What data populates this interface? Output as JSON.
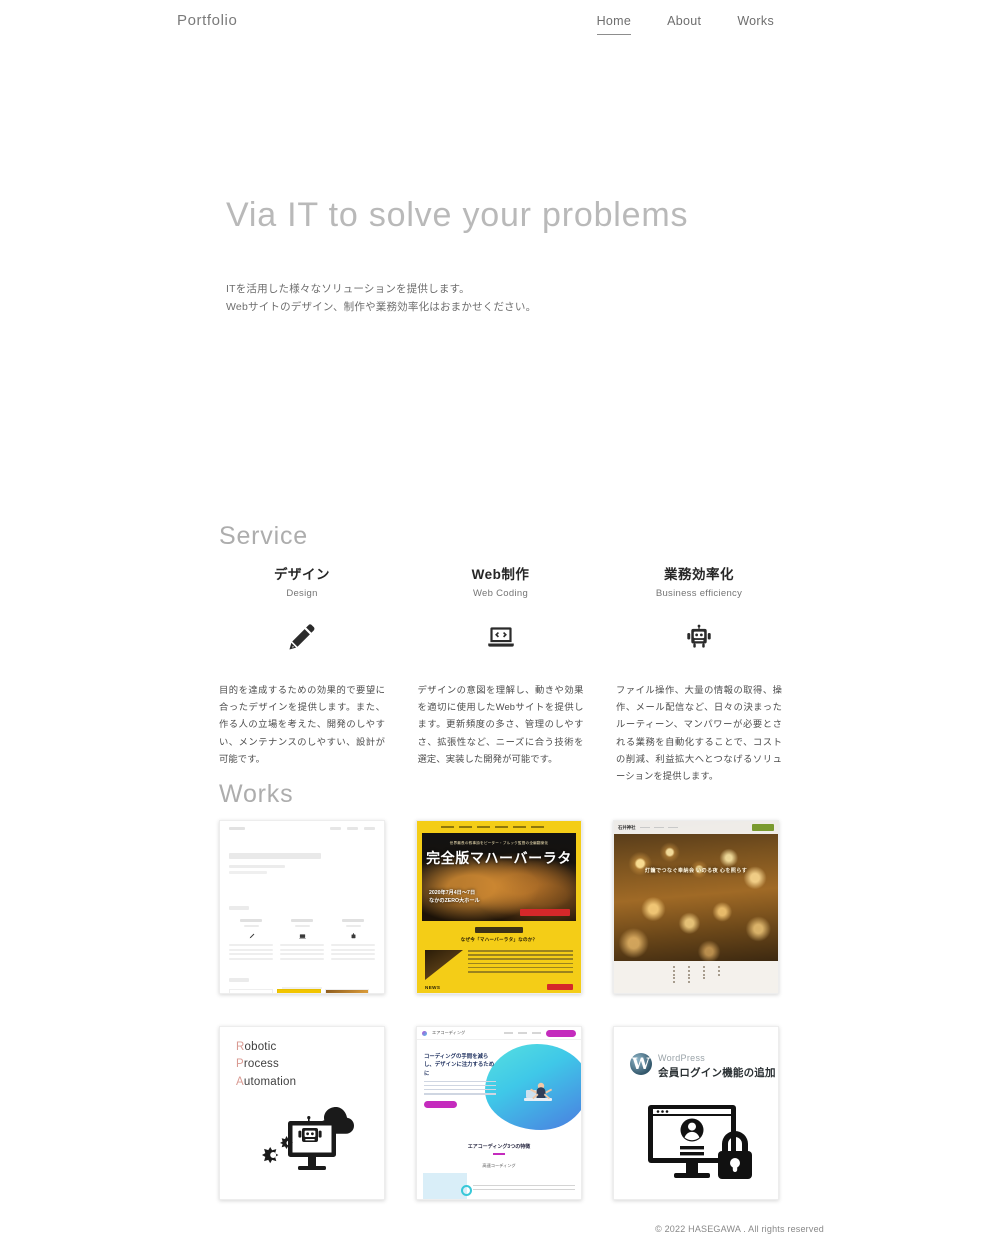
{
  "header": {
    "logo": "Portfolio",
    "nav": [
      {
        "label": "Home",
        "active": true
      },
      {
        "label": "About",
        "active": false
      },
      {
        "label": "Works",
        "active": false
      }
    ]
  },
  "hero": {
    "title": "Via IT to solve your problems",
    "sub_line1": "ITを活用した様々なソリューションを提供します。",
    "sub_line2": "Webサイトのデザイン、制作や業務効率化はおまかせください。"
  },
  "service": {
    "heading": "Service",
    "items": [
      {
        "title_jp": "デザイン",
        "title_en": "Design",
        "icon": "pen-nib-icon",
        "desc": "目的を達成するための効果的で要望に合ったデザインを提供します。また、作る人の立場を考えた、開発のしやすい、メンテナンスのしやすい、設計が可能です。"
      },
      {
        "title_jp": "Web制作",
        "title_en": "Web Coding",
        "icon": "laptop-code-icon",
        "desc": "デザインの意図を理解し、動きや効果を適切に使用したWebサイトを提供します。更新頻度の多さ、管理のしやすさ、拡張性など、ニーズに合う技術を選定、実装した開発が可能です。"
      },
      {
        "title_jp": "業務効率化",
        "title_en": "Business efficiency",
        "icon": "robot-icon",
        "desc": "ファイル操作、大量の情報の取得、操作、メール配信など、日々の決まったルーティーン、マンパワーが必要とされる業務を自動化することで、コストの削減、利益拡大へとつなげるソリューションを提供します。"
      }
    ]
  },
  "works": {
    "heading": "Works",
    "items": [
      {
        "id": "work-portfolio-site",
        "kind": "portfolio-screenshot",
        "alt": "Portfolio website screenshot"
      },
      {
        "id": "work-mahabharata",
        "kind": "poster-site",
        "kicker": "世界最長の叙事詩をピーター・ブルック監督の全編翻案化",
        "title": "完全版マハーバーラタ",
        "date_line1": "2020年7月4日〜7日",
        "date_line2": "なかのZERO大ホール",
        "intro_badge": "INTRODUCTION",
        "intro_q": "なぜ今「マハーバーラタ」なのか？",
        "news_label": "NEWS"
      },
      {
        "id": "work-lantern-festival",
        "kind": "photo-site",
        "brand": "石井神社",
        "headline": "灯籠でつなぐ奉納会 いのる夜 心を照らす",
        "cta": "お問合せ"
      },
      {
        "id": "work-rpa",
        "kind": "graphic",
        "line1_accent": "R",
        "line1_rest": "obotic",
        "line2_accent": "P",
        "line2_rest": "rocess",
        "line3_accent": "A",
        "line3_rest": "utomation",
        "icon": "rpa-monitor-robot-cloud-gears-icon"
      },
      {
        "id": "work-air-coding",
        "kind": "saas-site",
        "brand": "エアコーディング",
        "headline": "コーディングの手間を減らし、デザインに注力するために",
        "cta": "詳しくはこちら",
        "mid_title": "エアコーディング3つの特徴",
        "mid_sub": "高速コーディング"
      },
      {
        "id": "work-wordpress-login",
        "kind": "graphic",
        "brand": "WordPress",
        "title": "会員ログイン機能の追加",
        "icon": "monitor-user-lock-icon"
      }
    ]
  },
  "footer": {
    "copyright": "© 2022 HASEGAWA . All rights reserved"
  },
  "colors": {
    "text_dark": "#262626",
    "text_muted": "#6e6e6e",
    "heading_gray": "#adadad",
    "accent_yellow": "#f4cd17",
    "accent_magenta": "#c42bbd",
    "accent_salmon": "#d99a92"
  }
}
